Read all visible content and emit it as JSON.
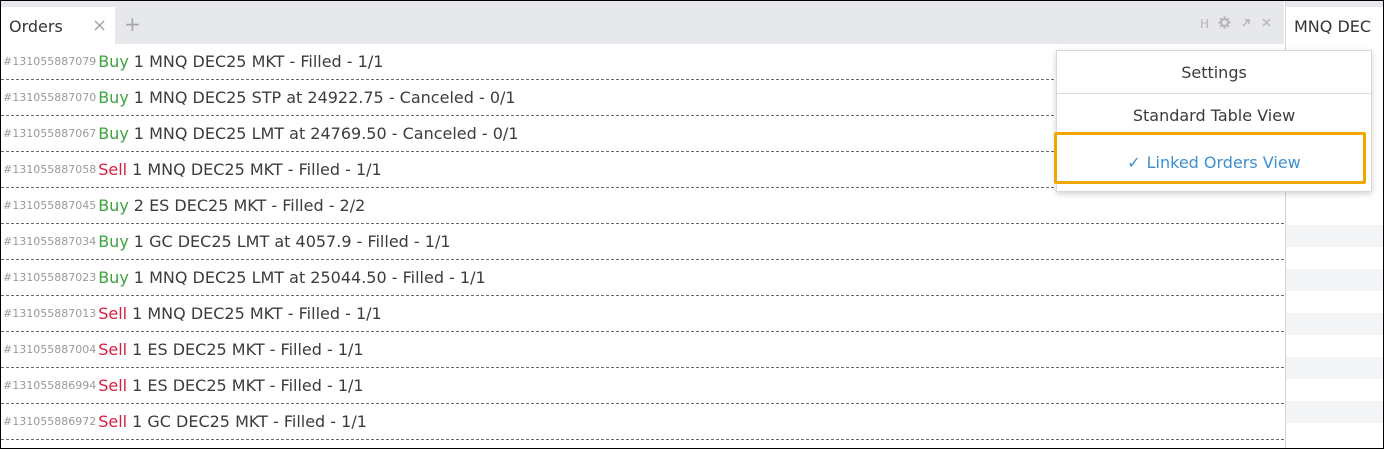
{
  "orders_tab": {
    "title": "Orders",
    "close_icon": "×",
    "add_icon": "+"
  },
  "panel_controls": {
    "h_label": "H",
    "gear": "gear-icon",
    "expand": "expand-icon",
    "close": "close-icon"
  },
  "right_panel": {
    "tab_title": "MNQ DEC"
  },
  "orders": [
    {
      "id": "#131055887079",
      "side": "Buy",
      "desc": "1 MNQ DEC25 MKT - Filled - 1/1"
    },
    {
      "id": "#131055887070",
      "side": "Buy",
      "desc": "1 MNQ DEC25 STP at 24922.75 - Canceled - 0/1"
    },
    {
      "id": "#131055887067",
      "side": "Buy",
      "desc": "1 MNQ DEC25 LMT at 24769.50 - Canceled - 0/1"
    },
    {
      "id": "#131055887058",
      "side": "Sell",
      "desc": "1 MNQ DEC25 MKT - Filled - 1/1"
    },
    {
      "id": "#131055887045",
      "side": "Buy",
      "desc": "2 ES DEC25 MKT - Filled - 2/2"
    },
    {
      "id": "#131055887034",
      "side": "Buy",
      "desc": "1 GC DEC25 LMT at 4057.9 - Filled - 1/1"
    },
    {
      "id": "#131055887023",
      "side": "Buy",
      "desc": "1 MNQ DEC25 LMT at 25044.50 - Filled - 1/1"
    },
    {
      "id": "#131055887013",
      "side": "Sell",
      "desc": "1 MNQ DEC25 MKT - Filled - 1/1"
    },
    {
      "id": "#131055887004",
      "side": "Sell",
      "desc": "1 ES DEC25 MKT - Filled - 1/1"
    },
    {
      "id": "#131055886994",
      "side": "Sell",
      "desc": "1 ES DEC25 MKT - Filled - 1/1"
    },
    {
      "id": "#131055886972",
      "side": "Sell",
      "desc": "1 GC DEC25 MKT - Filled - 1/1"
    }
  ],
  "menu": {
    "settings": "Settings",
    "standard_view": "Standard Table View",
    "linked_view": "Linked Orders View",
    "check_mark": "✓"
  },
  "colors": {
    "buy": "#3da33d",
    "sell": "#d81e3c",
    "accent": "#3e8fd0",
    "highlight": "#f0a800"
  }
}
